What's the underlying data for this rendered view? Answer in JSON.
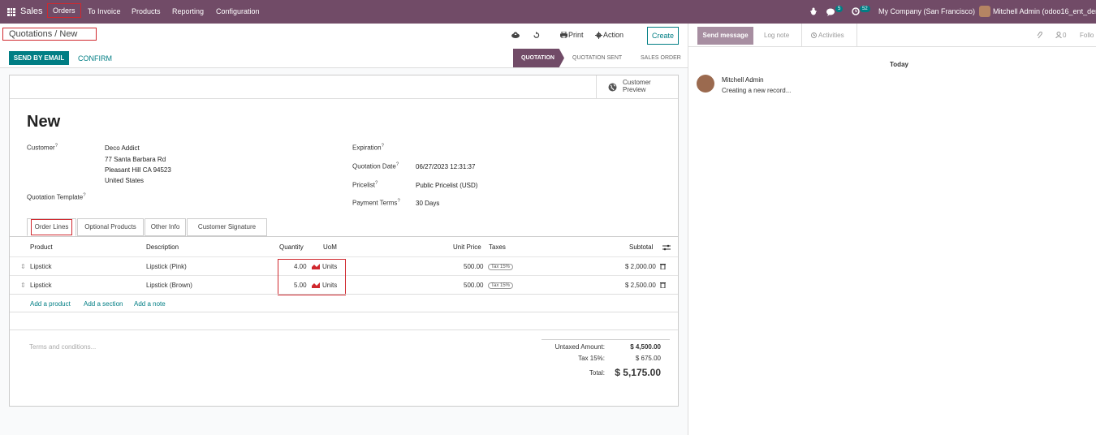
{
  "nav": {
    "app": "Sales",
    "menu": [
      "Orders",
      "To Invoice",
      "Products",
      "Reporting",
      "Configuration"
    ],
    "chat_count": "5",
    "activity_count": "52",
    "company": "My Company (San Francisco)",
    "user": "Mitchell Admin (odoo16_ent_dem"
  },
  "control": {
    "breadcrumb": "Quotations / New",
    "print": "Print",
    "action": "Action",
    "create": "Create",
    "send_email": "SEND BY EMAIL",
    "confirm": "CONFIRM",
    "statuses": [
      "QUOTATION",
      "QUOTATION SENT",
      "SALES ORDER"
    ]
  },
  "form": {
    "customer_preview": [
      "Customer",
      "Preview"
    ],
    "title": "New",
    "customer_label": "Customer",
    "customer_name": "Deco Addict",
    "customer_addr1": "77 Santa Barbara Rd",
    "customer_addr2": "Pleasant Hill CA 94523",
    "customer_addr3": "United States",
    "template_label": "Quotation Template",
    "expiration_label": "Expiration",
    "date_label": "Quotation Date",
    "date_value": "06/27/2023 12:31:37",
    "pricelist_label": "Pricelist",
    "pricelist_value": "Public Pricelist (USD)",
    "terms_label": "Payment Terms",
    "terms_value": "30 Days"
  },
  "tabs": [
    "Order Lines",
    "Optional Products",
    "Other Info",
    "Customer Signature"
  ],
  "table": {
    "headers": [
      "Product",
      "Description",
      "Quantity",
      "UoM",
      "Unit Price",
      "Taxes",
      "Subtotal"
    ],
    "rows": [
      {
        "product": "Lipstick",
        "description": "Lipstick (Pink)",
        "qty": "4.00",
        "uom": "Units",
        "price": "500.00",
        "tax": "Tax 15%",
        "subtotal": "$ 2,000.00"
      },
      {
        "product": "Lipstick",
        "description": "Lipstick (Brown)",
        "qty": "5.00",
        "uom": "Units",
        "price": "500.00",
        "tax": "Tax 15%",
        "subtotal": "$ 2,500.00"
      }
    ],
    "add_product": "Add a product",
    "add_section": "Add a section",
    "add_note": "Add a note"
  },
  "totals": {
    "terms_placeholder": "Terms and conditions...",
    "untaxed_label": "Untaxed Amount:",
    "untaxed_value": "$ 4,500.00",
    "tax_label": "Tax 15%:",
    "tax_value": "$ 675.00",
    "total_label": "Total:",
    "total_value": "$ 5,175.00"
  },
  "chatter": {
    "send_message": "Send message",
    "log_note": "Log note",
    "activities": "Activities",
    "attach_count": "0",
    "follow": "Follo",
    "today": "Today",
    "author": "Mitchell Admin",
    "message": "Creating a new record..."
  },
  "colors": {
    "brand": "#714B67",
    "accent": "#017e84"
  }
}
